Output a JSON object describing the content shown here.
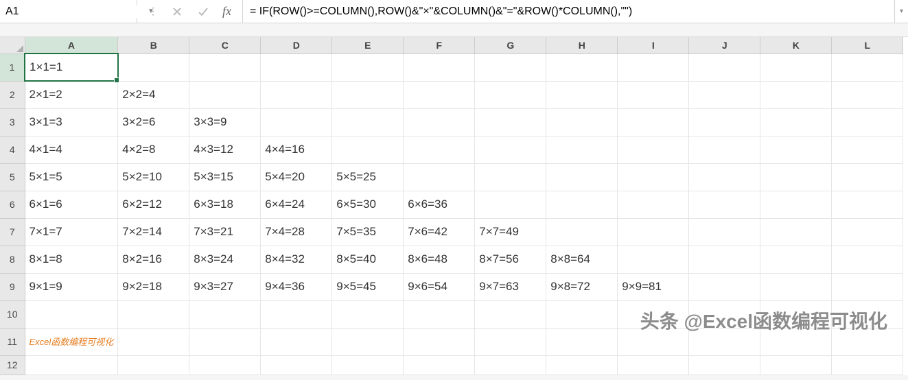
{
  "nameBox": {
    "value": "A1"
  },
  "formulaBar": {
    "fxLabel": "fx",
    "formula": "= IF(ROW()>=COLUMN(),ROW()&\"×\"&COLUMN()&\"=\"&ROW()*COLUMN(),\"\")"
  },
  "columns": [
    "A",
    "B",
    "C",
    "D",
    "E",
    "F",
    "G",
    "H",
    "I",
    "J",
    "K",
    "L"
  ],
  "activeCol": "A",
  "activeRow": 1,
  "rows": [
    {
      "num": 1,
      "cells": [
        "1×1=1",
        "",
        "",
        "",
        "",
        "",
        "",
        "",
        "",
        "",
        "",
        ""
      ]
    },
    {
      "num": 2,
      "cells": [
        "2×1=2",
        "2×2=4",
        "",
        "",
        "",
        "",
        "",
        "",
        "",
        "",
        "",
        ""
      ]
    },
    {
      "num": 3,
      "cells": [
        "3×1=3",
        "3×2=6",
        "3×3=9",
        "",
        "",
        "",
        "",
        "",
        "",
        "",
        "",
        ""
      ]
    },
    {
      "num": 4,
      "cells": [
        "4×1=4",
        "4×2=8",
        "4×3=12",
        "4×4=16",
        "",
        "",
        "",
        "",
        "",
        "",
        "",
        ""
      ]
    },
    {
      "num": 5,
      "cells": [
        "5×1=5",
        "5×2=10",
        "5×3=15",
        "5×4=20",
        "5×5=25",
        "",
        "",
        "",
        "",
        "",
        "",
        ""
      ]
    },
    {
      "num": 6,
      "cells": [
        "6×1=6",
        "6×2=12",
        "6×3=18",
        "6×4=24",
        "6×5=30",
        "6×6=36",
        "",
        "",
        "",
        "",
        "",
        ""
      ]
    },
    {
      "num": 7,
      "cells": [
        "7×1=7",
        "7×2=14",
        "7×3=21",
        "7×4=28",
        "7×5=35",
        "7×6=42",
        "7×7=49",
        "",
        "",
        "",
        "",
        ""
      ]
    },
    {
      "num": 8,
      "cells": [
        "8×1=8",
        "8×2=16",
        "8×3=24",
        "8×4=32",
        "8×5=40",
        "8×6=48",
        "8×7=56",
        "8×8=64",
        "",
        "",
        "",
        ""
      ]
    },
    {
      "num": 9,
      "cells": [
        "9×1=9",
        "9×2=18",
        "9×3=27",
        "9×4=36",
        "9×5=45",
        "9×6=54",
        "9×7=63",
        "9×8=72",
        "9×9=81",
        "",
        "",
        ""
      ]
    },
    {
      "num": 10,
      "cells": [
        "",
        "",
        "",
        "",
        "",
        "",
        "",
        "",
        "",
        "",
        "",
        ""
      ]
    },
    {
      "num": 11,
      "cells": [
        "Excel函数编程可视化",
        "",
        "",
        "",
        "",
        "",
        "",
        "",
        "",
        "",
        "",
        ""
      ],
      "watermark": true
    },
    {
      "num": 12,
      "cells": [
        "",
        "",
        "",
        "",
        "",
        "",
        "",
        "",
        "",
        "",
        "",
        ""
      ],
      "short": true
    }
  ],
  "overlayWatermark": "头条 @Excel函数编程可视化"
}
